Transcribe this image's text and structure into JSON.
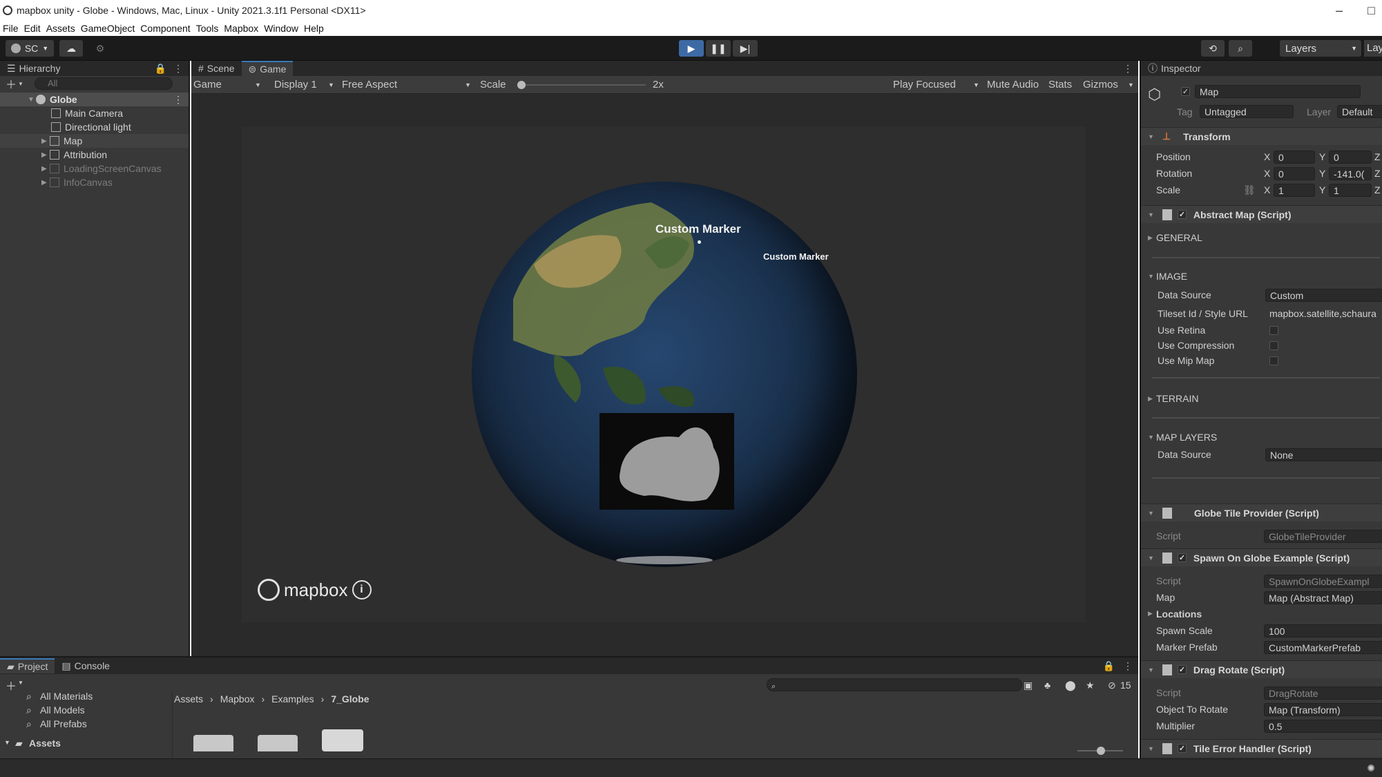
{
  "window": {
    "title": "mapbox unity - Globe - Windows, Mac, Linux - Unity 2021.3.1f1 Personal <DX11>",
    "controls": [
      "–",
      "□"
    ]
  },
  "menu": [
    "File",
    "Edit",
    "Assets",
    "GameObject",
    "Component",
    "Tools",
    "Mapbox",
    "Window",
    "Help"
  ],
  "toolbar": {
    "account": "SC",
    "layers": "Layers",
    "layout": "Lay"
  },
  "hierarchy": {
    "title": "Hierarchy",
    "search_placeholder": "All",
    "items": [
      {
        "label": "Globe"
      },
      {
        "label": "Main Camera"
      },
      {
        "label": "Directional light"
      },
      {
        "label": "Map"
      },
      {
        "label": "Attribution"
      },
      {
        "label": "LoadingScreenCanvas"
      },
      {
        "label": "InfoCanvas"
      }
    ]
  },
  "game": {
    "tabs": [
      "Scene",
      "Game"
    ],
    "mode": "Game",
    "display": "Display 1",
    "aspect": "Free Aspect",
    "scale_label": "Scale",
    "scale_value": "2x",
    "scale_level": 0.0,
    "play_focused": "Play Focused",
    "mute_audio": "Mute Audio",
    "stats": "Stats",
    "gizmos": "Gizmos",
    "marker1": "Custom Marker",
    "marker2": "Custom Marker",
    "logo": "mapbox"
  },
  "inspector": {
    "title": "Inspector",
    "object_name": "Map",
    "tag_label": "Tag",
    "tag": "Untagged",
    "layer_label": "Layer",
    "layer": "Default",
    "transform": {
      "title": "Transform",
      "position": "Position",
      "rotation": "Rotation",
      "scale": "Scale",
      "pos_x": "0",
      "pos_y": "0",
      "rot_x": "0",
      "rot_y": "-141.0(",
      "scale_x": "1",
      "scale_y": "1",
      "x": "X",
      "y": "Y",
      "z": "Z"
    },
    "abstract_map": {
      "title": "Abstract Map (Script)",
      "general": "GENERAL",
      "image": "IMAGE",
      "data_source_label": "Data Source",
      "data_source": "Custom",
      "tileset_label": "Tileset Id / Style URL",
      "tileset": "mapbox.satellite,schaura",
      "use_retina": "Use Retina",
      "use_compression": "Use Compression",
      "use_mip_map": "Use Mip Map",
      "terrain": "TERRAIN",
      "map_layers": "MAP LAYERS",
      "layers_source_label": "Data Source",
      "layers_source": "None"
    },
    "globe_tile_provider": {
      "title": "Globe Tile Provider (Script)",
      "script_label": "Script",
      "script": "GlobeTileProvider"
    },
    "spawn": {
      "title": "Spawn On Globe Example (Script)",
      "script_label": "Script",
      "script": "SpawnOnGlobeExampl",
      "map_label": "Map",
      "map": "Map (Abstract Map)",
      "locations": "Locations",
      "spawn_scale_label": "Spawn Scale",
      "spawn_scale": "100",
      "marker_prefab_label": "Marker Prefab",
      "marker_prefab": "CustomMarkerPrefab"
    },
    "drag_rotate": {
      "title": "Drag Rotate (Script)",
      "script_label": "Script",
      "script": "DragRotate",
      "object_label": "Object To Rotate",
      "object": "Map (Transform)",
      "multiplier_label": "Multiplier",
      "multiplier": "0.5"
    },
    "tile_error": {
      "title": "Tile Error Handler (Script)"
    }
  },
  "project": {
    "tabs": [
      "Project",
      "Console"
    ],
    "favorites": [
      "All Materials",
      "All Models",
      "All Prefabs"
    ],
    "assets_root": "Assets",
    "breadcrumb": [
      "Assets",
      "Mapbox",
      "Examples",
      "7_Globe"
    ],
    "hidden_count": "15"
  },
  "colors": {
    "accent": "#3d6aa5",
    "selection": "#4d4d4d",
    "panel": "#383838",
    "viewport": "#2e2e2e"
  }
}
